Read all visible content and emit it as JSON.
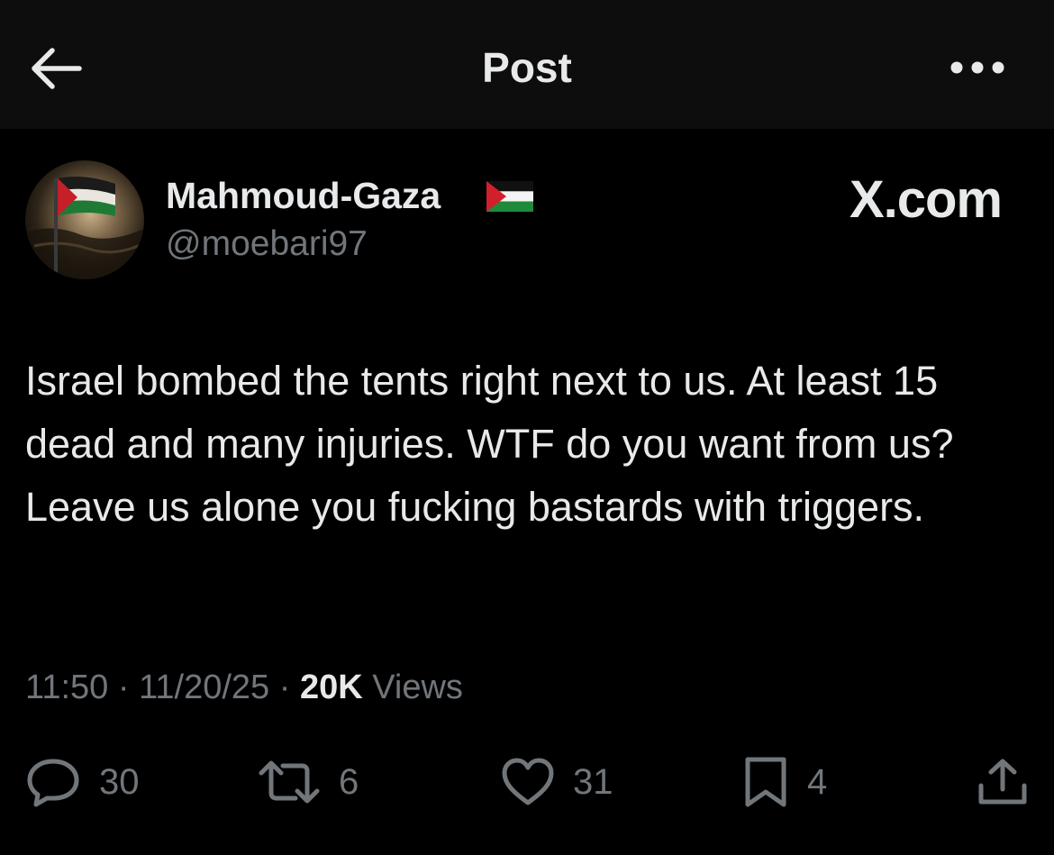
{
  "header": {
    "title": "Post"
  },
  "post": {
    "author_name": "Mahmoud-Gaza",
    "author_handle": "@moebari97",
    "watermark": "X.com",
    "text": "Israel bombed the tents right next to us. At least 15 dead and many injuries. WTF do you want from us? Leave us alone you fucking bastards with triggers.",
    "time": "11:50",
    "date": "11/20/25",
    "views_count": "20K",
    "views_label": "Views",
    "separator": "·"
  },
  "actions": {
    "replies": "30",
    "reposts": "6",
    "likes": "31",
    "bookmarks": "4"
  },
  "icons": {
    "back": "arrow-left-icon",
    "more": "more-horizontal-icon",
    "reply": "reply-bubble-icon",
    "repost": "repost-icon",
    "like": "heart-icon",
    "bookmark": "bookmark-icon",
    "share": "share-upload-icon",
    "flag": "palestine-flag-icon"
  },
  "colors": {
    "background": "#000000",
    "header_background": "#0d0d0d",
    "primary_text": "#e7e9ea",
    "secondary_text": "#71767b"
  }
}
